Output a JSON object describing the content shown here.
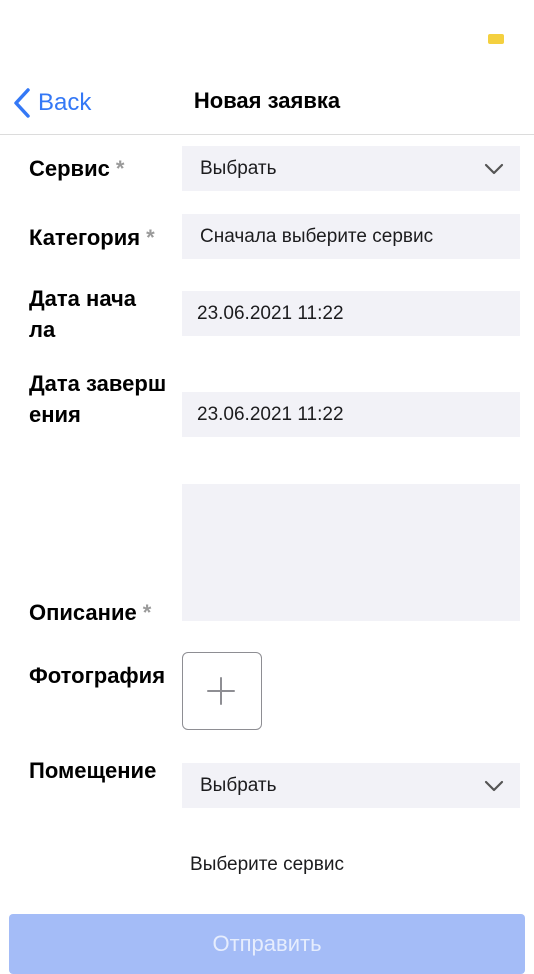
{
  "nav": {
    "back_label": "Back",
    "title": "Новая заявка"
  },
  "form": {
    "required_mark": "*",
    "service": {
      "label": "Сервис",
      "value": "Выбрать"
    },
    "category": {
      "label": "Категория",
      "value": "Сначала выберите сервис"
    },
    "start_date": {
      "label": "Дата начала",
      "value": "23.06.2021 11:22"
    },
    "end_date": {
      "label": "Дата завершения",
      "value": "23.06.2021 11:22"
    },
    "description": {
      "label": "Описание",
      "value": ""
    },
    "photo": {
      "label": "Фотография"
    },
    "room": {
      "label": "Помещение",
      "value": "Выбрать"
    }
  },
  "hint": "Выберите сервис",
  "submit_label": "Отправить",
  "colors": {
    "accent": "#3478f6",
    "field_bg": "#f2f2f7",
    "submit_bg": "#a4bcf7",
    "battery": "#f4d03f"
  }
}
